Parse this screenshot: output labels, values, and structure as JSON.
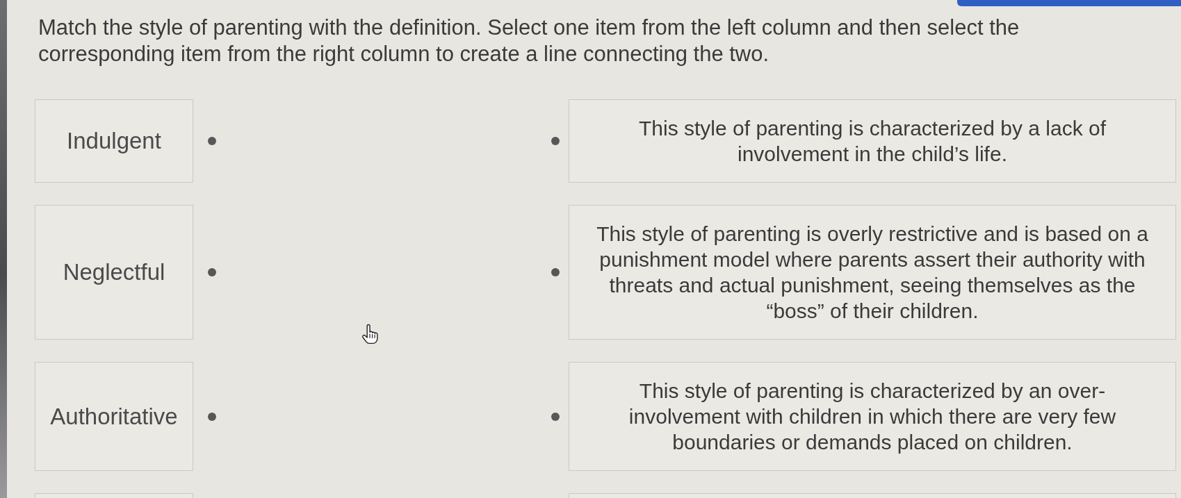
{
  "instruction": "Match the style of parenting with the definition. Select one item from the left column and then select the corresponding item from the right column to create a line connecting the two.",
  "terms": [
    {
      "kind": "option",
      "text": "Indulgent"
    },
    {
      "kind": "option",
      "text": "Neglectful"
    },
    {
      "kind": "option",
      "text": "Authoritative"
    },
    {
      "kind": "clipped"
    }
  ],
  "definitions": [
    {
      "kind": "option",
      "text": "This style of parenting is characterized by a lack of involvement in the child’s life."
    },
    {
      "kind": "option",
      "text": "This style of parenting is overly restrictive and is based on a punishment model where parents assert their authority with threats and actual punishment, seeing themselves as the “boss” of their children."
    },
    {
      "kind": "option",
      "text": "This style of parenting is characterized by an over-involvement with children in which there are very few boundaries or demands placed on children."
    },
    {
      "kind": "clipped"
    }
  ]
}
